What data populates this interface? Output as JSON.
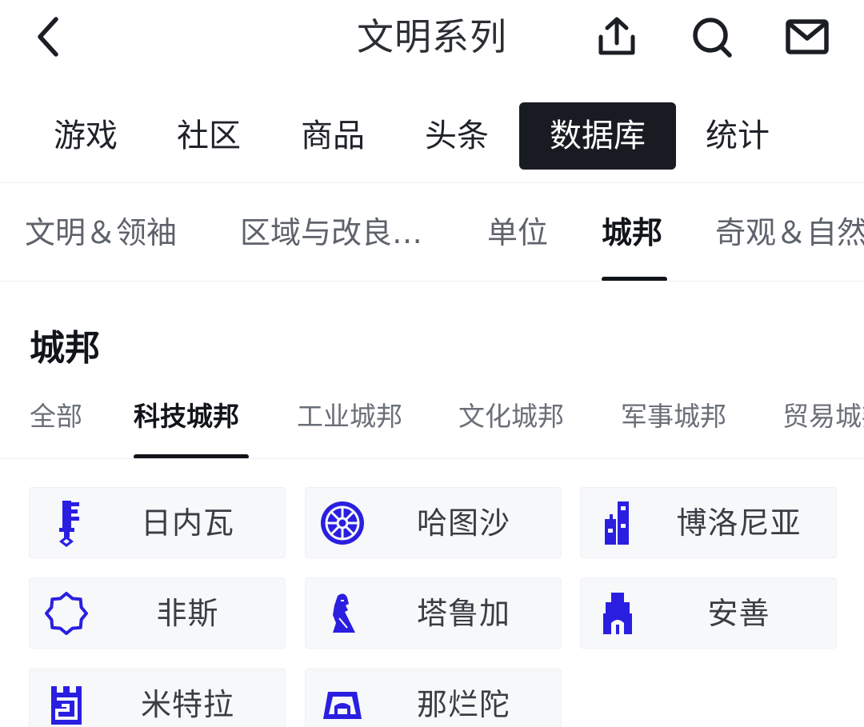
{
  "header": {
    "title": "文明系列",
    "back_icon": "chevron-left-icon",
    "share_icon": "share-icon",
    "search_icon": "search-icon",
    "mail_icon": "mail-icon"
  },
  "main_tabs": [
    {
      "label": "游戏"
    },
    {
      "label": "社区"
    },
    {
      "label": "商品"
    },
    {
      "label": "头条"
    },
    {
      "label": "数据库",
      "active": true
    },
    {
      "label": "统计"
    }
  ],
  "sub_tabs": [
    {
      "label": "文明＆领袖"
    },
    {
      "label": "区域与改良…"
    },
    {
      "label": "单位"
    },
    {
      "label": "城邦",
      "active": true
    },
    {
      "label": "奇观＆自然"
    }
  ],
  "section": {
    "title": "城邦",
    "categories": [
      {
        "label": "全部"
      },
      {
        "label": "科技城邦",
        "active": true
      },
      {
        "label": "工业城邦"
      },
      {
        "label": "文化城邦"
      },
      {
        "label": "军事城邦"
      },
      {
        "label": "贸易城邦"
      }
    ]
  },
  "city_states": [
    {
      "name": "日内瓦",
      "icon": "key-icon"
    },
    {
      "name": "哈图沙",
      "icon": "wheel-icon"
    },
    {
      "name": "博洛尼亚",
      "icon": "tower-icon"
    },
    {
      "name": "非斯",
      "icon": "star-outline-icon"
    },
    {
      "name": "塔鲁加",
      "icon": "bust-icon"
    },
    {
      "name": "安善",
      "icon": "gate-icon"
    },
    {
      "name": "米特拉",
      "icon": "glyph-icon"
    },
    {
      "name": "那烂陀",
      "icon": "arch-icon"
    }
  ],
  "colors": {
    "icon_accent": "#2a1fe0",
    "active_tab_bg": "#181c22",
    "card_bg": "#f7f8fa"
  }
}
